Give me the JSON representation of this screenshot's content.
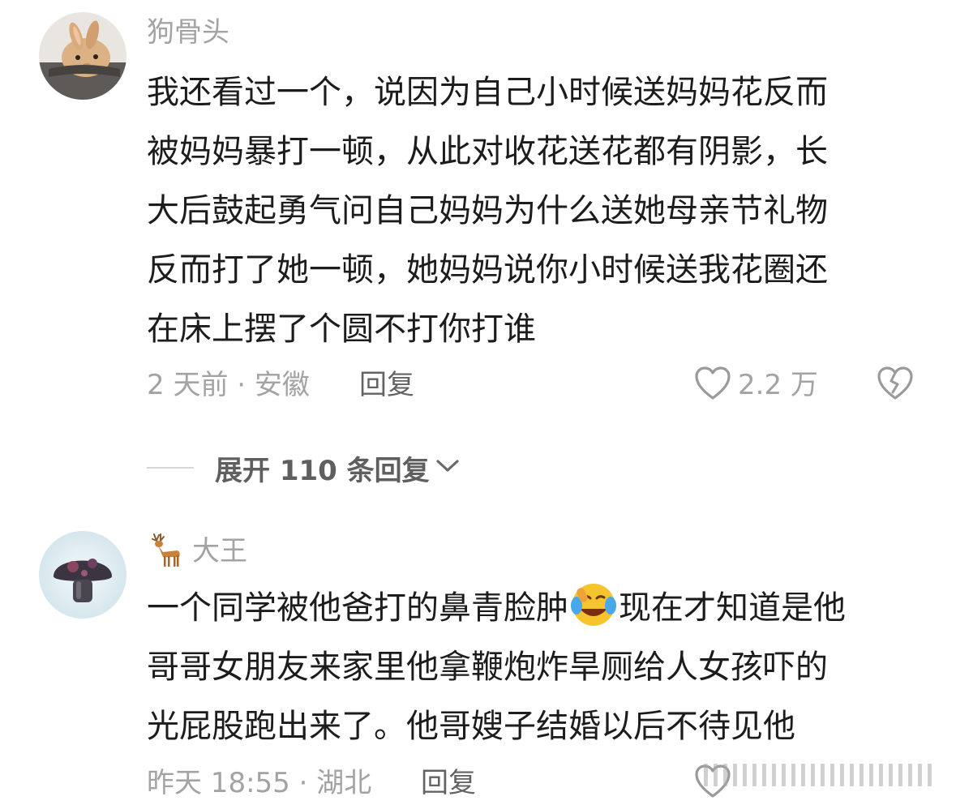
{
  "comments": [
    {
      "avatar": "rabbit-avatar",
      "username": "狗骨头",
      "text_lines": [
        "我还看过一个，说因为自己小时候送妈妈花反而",
        "被妈妈暴打一顿，从此对收花送花都有阴影，长",
        "大后鼓起勇气问自己妈妈为什么送她母亲节礼物",
        "反而打了她一顿，她妈妈说你小时候送我花圈还",
        "在床上摆了个圆不打你打谁"
      ],
      "time_location": "2 天前 · 安徽",
      "reply_label": "回复",
      "like_count": "2.2 万",
      "like_icon": "heart-outline-icon",
      "dislike_icon": "broken-heart-icon"
    },
    {
      "avatar": "mushroom-avatar",
      "badge_icon": "deer-icon",
      "username": "大王",
      "text_lines_before_emoji": "一个同学被他爸打的鼻青脸肿",
      "emoji": "laughing-crying-emoji",
      "text_lines_after_emoji": "现在才知道是他",
      "text_lines": [
        "哥哥女朋友来家里他拿鞭炮炸旱厕给人女孩吓的",
        "光屁股跑出来了。他哥嫂子结婚以后不待见他"
      ],
      "time_location": "昨天 18:55 · 湖北",
      "reply_label": "回复",
      "like_icon": "heart-outline-icon"
    }
  ],
  "expand_replies": {
    "label": "展开 110 条回复",
    "icon": "chevron-down-icon"
  },
  "colors": {
    "meta_gray": "#a3a3a3",
    "body_text": "#1c1c1c",
    "reply_gray": "#636363"
  }
}
